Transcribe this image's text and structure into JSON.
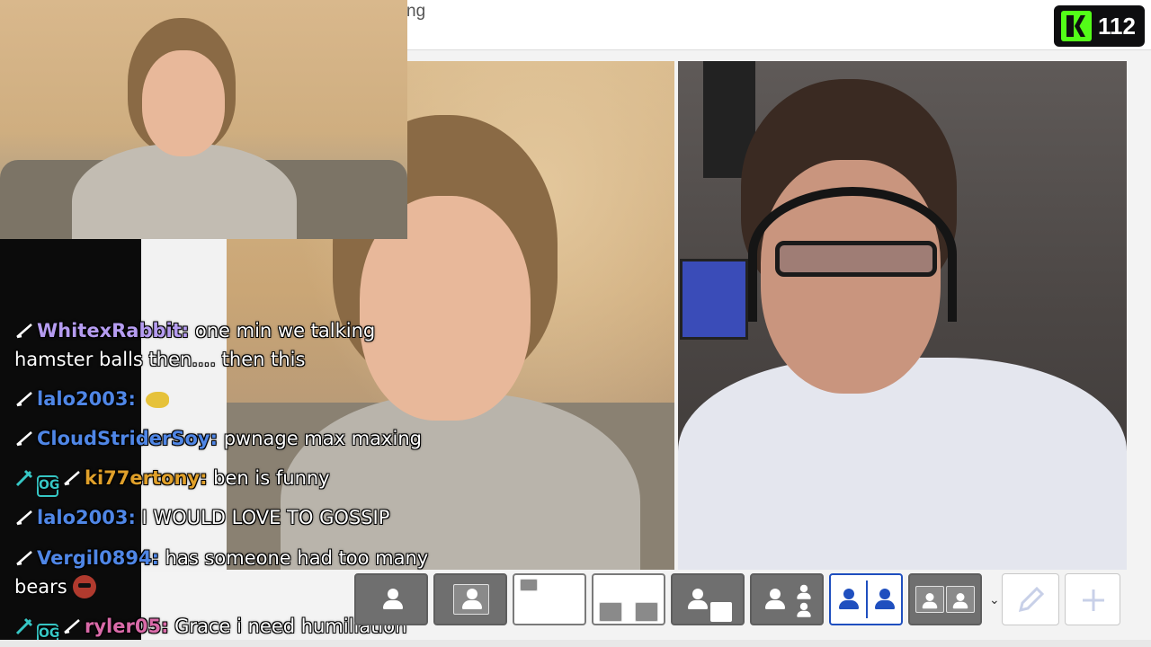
{
  "topbar": {
    "title_fragment": "ng"
  },
  "viewer_badge": {
    "count": "112",
    "icon": "kick-logo-icon",
    "accent": "#53fc18"
  },
  "chat": {
    "messages": [
      {
        "badges": [
          "sub-icon"
        ],
        "user": "WhitexRabbit",
        "user_color": "#b59cf0",
        "text": " one min we talking",
        "continuation": "hamster balls then.... then this"
      },
      {
        "badges": [
          "sub-icon"
        ],
        "user": "lalo2003",
        "user_color": "#4f86e6",
        "text": " ",
        "emote": "fish-emote"
      },
      {
        "badges": [
          "sub-icon"
        ],
        "user": "CloudStriderSoy",
        "user_color": "#4f86e6",
        "text": " pwnage max maxing"
      },
      {
        "badges": [
          "pin-icon",
          "og-badge-icon",
          "sub-icon"
        ],
        "badge_text": "OG",
        "user": "ki77ertony",
        "user_color": "#e0a02a",
        "text": " ben is funny"
      },
      {
        "badges": [
          "sub-icon"
        ],
        "user": "lalo2003",
        "user_color": "#4f86e6",
        "text": " I WOULD LOVE TO GOSSIP"
      },
      {
        "badges": [
          "sub-icon"
        ],
        "user": "Vergil0894",
        "user_color": "#4f86e6",
        "text": " has someone had too many",
        "continuation": "bears",
        "emote": "bear-emote"
      },
      {
        "badges": [
          "pin-icon",
          "og-badge-icon",
          "sub-icon"
        ],
        "badge_text": "OG",
        "user": "ryler05",
        "user_color": "#d96aa8",
        "text": " Grace i need humiliation"
      }
    ]
  },
  "layout_toolbar": {
    "buttons": [
      "layout-single-person-icon",
      "layout-single-framed-icon",
      "layout-empty-small-icon",
      "layout-two-small-icon",
      "layout-split-person-icon",
      "layout-one-plus-two-icon",
      "layout-side-by-side-icon",
      "layout-two-framed-icon",
      "edit-icon",
      "add-icon"
    ],
    "selected": "layout-side-by-side-icon",
    "accent": "#1f4fbf"
  }
}
